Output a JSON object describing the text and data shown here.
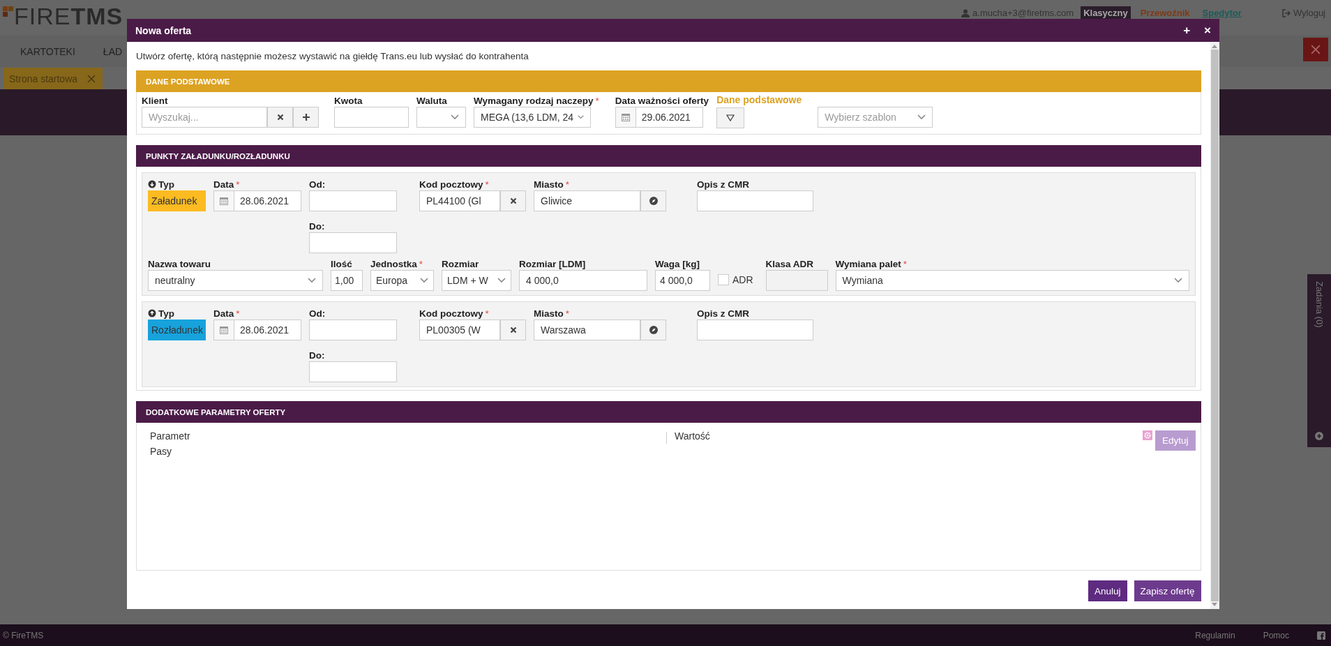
{
  "background": {
    "logo": {
      "light": "FIRE",
      "bold": "TMS"
    },
    "user": "a.mucha+3@firetms.com",
    "modes": [
      {
        "label": "Klasyczny",
        "selected": true,
        "color": "#2b1d2b"
      },
      {
        "label": "Przewoźnik",
        "selected": false,
        "color": "#7d3a17"
      },
      {
        "label": "Spedytor",
        "selected": false,
        "color": "#1d5a58"
      }
    ],
    "logout": "Wyloguj",
    "nav": [
      "KARTOTEKI",
      "ŁAD"
    ],
    "open_tab": "Strona startowa",
    "side_panel": "Zadania (0)",
    "footer": {
      "copyright": "© FireTMS",
      "links": [
        "Regulamin",
        "Pomoc"
      ]
    }
  },
  "modal": {
    "title": "Nowa oferta",
    "controls": [
      "+",
      "×"
    ],
    "intro": "Utwórz ofertę, którą następnie możesz wystawić na giełdę Trans.eu lub wysłać do kontrahenta",
    "basic": {
      "title": "DANE PODSTAWOWE",
      "client": {
        "label": "Klient",
        "placeholder": "Wyszukaj..."
      },
      "amount": {
        "label": "Kwota"
      },
      "currency": {
        "label": "Waluta"
      },
      "trailer": {
        "label": "Wymagany rodzaj naczepy",
        "required_mark": "*",
        "value": "MEGA (13,6 LDM, 24"
      },
      "valid_until": {
        "label": "Data ważności oferty",
        "value": "29.06.2021"
      },
      "preset": {
        "label": "Dane podstawowe"
      },
      "template": {
        "placeholder": "Wybierz szablon"
      }
    },
    "points": {
      "title": "PUNKTY ZAŁADUNKU/ROZŁADUNKU",
      "stops": [
        {
          "kind": "loading",
          "type": {
            "label": "Typ",
            "value": "Załadunek",
            "color": "#fbbb21"
          },
          "date": {
            "label": "Data",
            "required_mark": "*",
            "value": "28.06.2021"
          },
          "from": {
            "label": "Od:"
          },
          "to": {
            "label": "Do:"
          },
          "zip": {
            "label": "Kod pocztowy",
            "required_mark": "*",
            "value": "PL44100 (Gl"
          },
          "city": {
            "label": "Miasto",
            "required_mark": "*",
            "value": "Gliwice"
          },
          "cmr": {
            "label": "Opis z CMR"
          },
          "cargo": {
            "name": {
              "label": "Nazwa towaru",
              "value": "neutralny"
            },
            "quantity": {
              "label": "Ilość",
              "value": "1,00"
            },
            "unit": {
              "label": "Jednostka",
              "required_mark": "*",
              "value": "Europa"
            },
            "size": {
              "label": "Rozmiar",
              "value": "LDM + W"
            },
            "ldm": {
              "label": "Rozmiar [LDM]",
              "value": "4 000,0"
            },
            "weight": {
              "label": "Waga [kg]",
              "value": "4 000,0"
            },
            "adr": {
              "label": "ADR",
              "checked": false
            },
            "adr_class": {
              "label": "Klasa ADR",
              "disabled": true
            },
            "pallets": {
              "label": "Wymiana palet",
              "required_mark": "*",
              "value": "Wymiana"
            }
          }
        },
        {
          "kind": "unloading",
          "type": {
            "label": "Typ",
            "value": "Rozładunek",
            "color": "#17a2dc"
          },
          "date": {
            "label": "Data",
            "required_mark": "*",
            "value": "28.06.2021"
          },
          "from": {
            "label": "Od:"
          },
          "to": {
            "label": "Do:"
          },
          "zip": {
            "label": "Kod pocztowy",
            "required_mark": "*",
            "value": "PL00305 (W"
          },
          "city": {
            "label": "Miasto",
            "required_mark": "*",
            "value": "Warszawa"
          },
          "cmr": {
            "label": "Opis z CMR"
          }
        }
      ]
    },
    "extra": {
      "title": "DODATKOWE PARAMETRY OFERTY",
      "columns": [
        "Parametr",
        "Wartość"
      ],
      "rows": [
        {
          "parameter": "Pasy"
        }
      ],
      "edit": "Edytuj"
    },
    "buttons": [
      "Anuluj",
      "Zapisz ofertę"
    ]
  }
}
